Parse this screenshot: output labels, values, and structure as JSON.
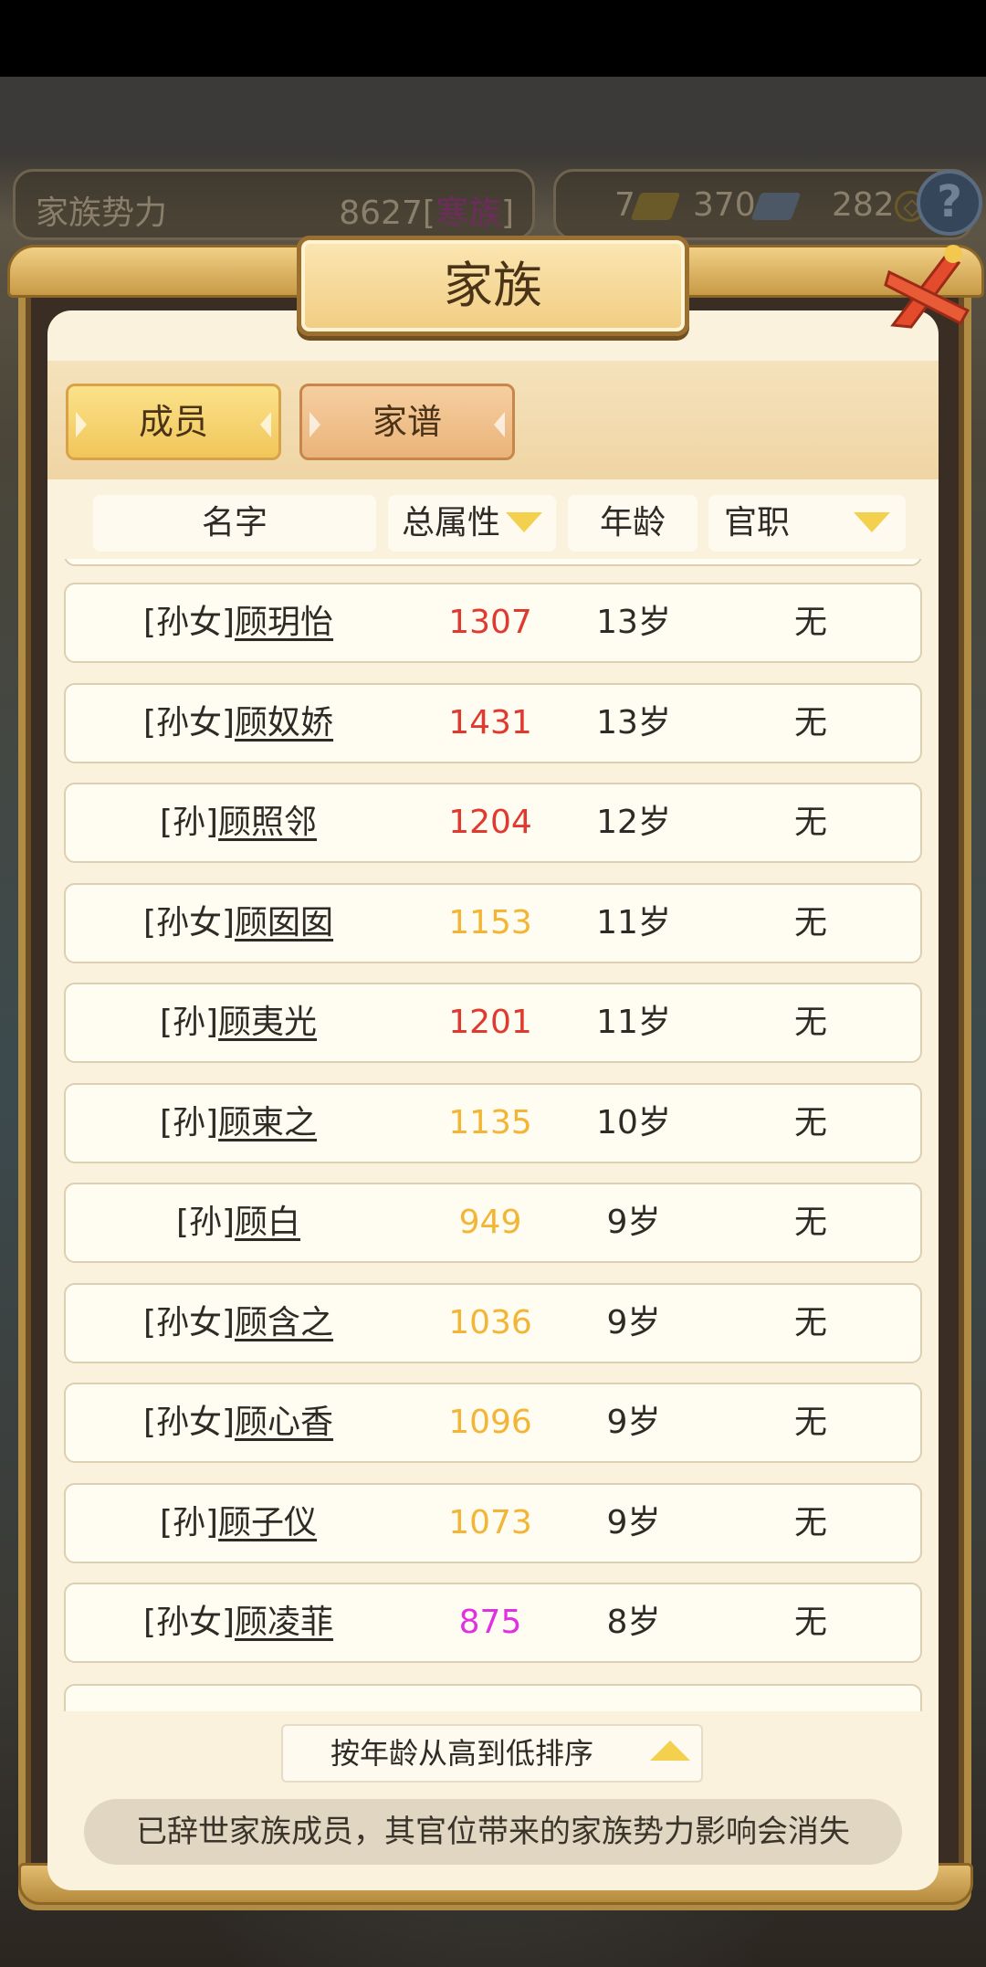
{
  "resource_bar": {
    "family_power_label": "家族势力",
    "family_power_value": "8627",
    "family_power_rank": "寒族",
    "gold": "7",
    "silver": "370",
    "coins": "282",
    "help": "?"
  },
  "dialog": {
    "title": "家族",
    "tabs": {
      "members": "成员",
      "genealogy": "家谱"
    },
    "columns": {
      "name": "名字",
      "attr": "总属性",
      "age": "年龄",
      "office": "官职"
    }
  },
  "colors": {
    "red": "#e0392f",
    "orange": "#f2b535",
    "magenta": "#e030e0"
  },
  "members": [
    {
      "prefix": "[孙女]",
      "name": "顾玥怡",
      "attr": "1307",
      "attr_color": "#e0392f",
      "age": "13岁",
      "office": "无"
    },
    {
      "prefix": "[孙女]",
      "name": "顾奴娇",
      "attr": "1431",
      "attr_color": "#e0392f",
      "age": "13岁",
      "office": "无"
    },
    {
      "prefix": "[孙]",
      "name": "顾照邻",
      "attr": "1204",
      "attr_color": "#e0392f",
      "age": "12岁",
      "office": "无"
    },
    {
      "prefix": "[孙女]",
      "name": "顾囡囡",
      "attr": "1153",
      "attr_color": "#f2b535",
      "age": "11岁",
      "office": "无"
    },
    {
      "prefix": "[孙]",
      "name": "顾夷光",
      "attr": "1201",
      "attr_color": "#e0392f",
      "age": "11岁",
      "office": "无"
    },
    {
      "prefix": "[孙]",
      "name": "顾柬之",
      "attr": "1135",
      "attr_color": "#f2b535",
      "age": "10岁",
      "office": "无"
    },
    {
      "prefix": "[孙]",
      "name": "顾白",
      "attr": "949",
      "attr_color": "#f2b535",
      "age": "9岁",
      "office": "无"
    },
    {
      "prefix": "[孙女]",
      "name": "顾含之",
      "attr": "1036",
      "attr_color": "#f2b535",
      "age": "9岁",
      "office": "无"
    },
    {
      "prefix": "[孙女]",
      "name": "顾心香",
      "attr": "1096",
      "attr_color": "#f2b535",
      "age": "9岁",
      "office": "无"
    },
    {
      "prefix": "[孙]",
      "name": "顾子仪",
      "attr": "1073",
      "attr_color": "#f2b535",
      "age": "9岁",
      "office": "无"
    },
    {
      "prefix": "[孙女]",
      "name": "顾凌菲",
      "attr": "875",
      "attr_color": "#e030e0",
      "age": "8岁",
      "office": "无"
    }
  ],
  "sort_button": "按年龄从高到低排序",
  "notice": "已辞世家族成员，其官位带来的家族势力影响会消失"
}
